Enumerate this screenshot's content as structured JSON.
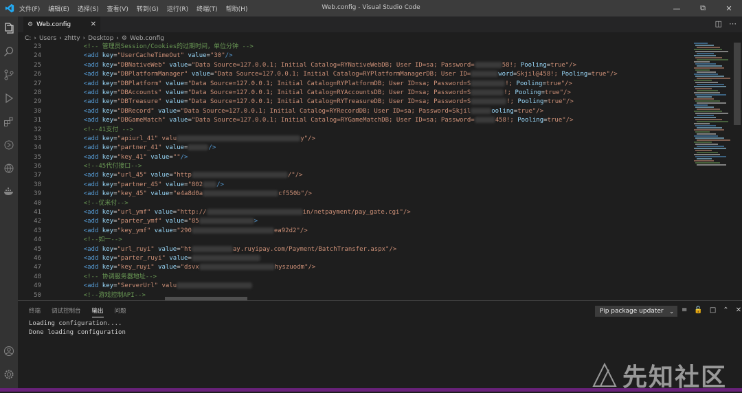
{
  "window": {
    "title": "Web.config - Visual Studio Code",
    "menu": [
      "文件(F)",
      "编辑(E)",
      "选择(S)",
      "查看(V)",
      "转到(G)",
      "运行(R)",
      "终端(T)",
      "帮助(H)"
    ]
  },
  "tab": {
    "label": "Web.config"
  },
  "breadcrumb": {
    "parts": [
      "C:",
      "Users",
      "zhtty",
      "Desktop",
      "Web.config"
    ]
  },
  "editor": {
    "lines": [
      {
        "n": "23",
        "text": "<!-- 管理员Session/Cookies的过期时间，单位分钟 -->"
      },
      {
        "n": "24",
        "text": "<add key=\"UserCacheTimeOut\" value=\"30\"/>"
      },
      {
        "n": "25",
        "text": "<add key=\"DBNativeWeb\" value=\"Data Source=127.0.0.1; Initial Catalog=RYNativeWebDB; User ID=sa; Password=",
        "tail": "58!; Pooling=true\"/>"
      },
      {
        "n": "26",
        "text": "<add key=\"DBPlatformManager\" value=\"Data Source=127.0.0.1; Initial Catalog=RYPlatformManagerDB; User ID=",
        "tail": "word=Skjil@458!; Pooling=true\"/>"
      },
      {
        "n": "27",
        "text": "<add key=\"DBPlatform\" value=\"Data Source=127.0.0.1; Initial Catalog=RYPlatformDB; User ID=sa; Password=S",
        "tail": "!; Pooling=true\"/>"
      },
      {
        "n": "28",
        "text": "<add key=\"DBAccounts\" value=\"Data Source=127.0.0.1; Initial Catalog=RYAccountsDB; User ID=sa; Password=S",
        "tail": "!; Pooling=true\"/>"
      },
      {
        "n": "29",
        "text": "<add key=\"DBTreasure\" value=\"Data Source=127.0.0.1; Initial Catalog=RYTreasureDB; User ID=sa; Password=S",
        "tail": "!; Pooling=true\"/>"
      },
      {
        "n": "30",
        "text": "<add key=\"DBRecord\" value=\"Data Source=127.0.0.1; Initial Catalog=RYRecordDB; User ID=sa; Password=Skjil",
        "tail": "ooling=true\"/>"
      },
      {
        "n": "31",
        "text": "<add key=\"DBGameMatch\" value=\"Data Source=127.0.0.1; Initial Catalog=RYGameMatchDB; User ID=sa; Password=",
        "tail": "458!; Pooling=true\"/>"
      },
      {
        "n": "32",
        "text": "<!--41支付 -->"
      },
      {
        "n": "33",
        "text": "<add key=\"apiurl_41\" valu",
        "tail": "y\"/>"
      },
      {
        "n": "34",
        "text": "<add key=\"partner_41\" value=",
        "tail": "/>"
      },
      {
        "n": "35",
        "text": "<add key=\"key_41\" value=\"\"/>"
      },
      {
        "n": "36",
        "text": "<!--45代付接口-->"
      },
      {
        "n": "37",
        "text": "<add key=\"url_45\" value=\"http",
        "tail": "/\"/>"
      },
      {
        "n": "38",
        "text": "<add key=\"partner_45\" value=\"802",
        "tail": "/>"
      },
      {
        "n": "39",
        "text": "<add key=\"key_45\" value=\"e4a8d0a",
        "tail": "cf550b\"/>"
      },
      {
        "n": "40",
        "text": "<!--优米付-->"
      },
      {
        "n": "41",
        "text": "<add key=\"url_ymf\" value=\"http://",
        "tail": "in/netpayment/pay_gate.cgi\"/>"
      },
      {
        "n": "42",
        "text": "<add key=\"parter_ymf\" value=\"85",
        "tail": ">"
      },
      {
        "n": "43",
        "text": "<add key=\"key_ymf\" value=\"290",
        "tail": "ea92d2\"/>"
      },
      {
        "n": "44",
        "text": "<!--如一-->"
      },
      {
        "n": "45",
        "text": "<add key=\"url_ruyi\" value=\"ht",
        "tail": "ay.ruyipay.com/Payment/BatchTransfer.aspx\"/>"
      },
      {
        "n": "46",
        "text": "<add key=\"parter_ruyi\" value=",
        "tail": ""
      },
      {
        "n": "47",
        "text": "<add key=\"key_ruyi\" value=\"dsvx",
        "tail": "hyszuodm\"/>"
      },
      {
        "n": "48",
        "text": "<!-- 协调服务器地址-->"
      },
      {
        "n": "49",
        "text": "<add key=\"ServerUrl\" valu",
        "tail": ""
      },
      {
        "n": "50",
        "text": "<!--游戏控制API-->"
      }
    ]
  },
  "panel": {
    "tabs": [
      "终端",
      "调试控制台",
      "输出",
      "问题"
    ],
    "active_tab": "输出",
    "select_value": "Pip package updater",
    "output": [
      "Loading configuration....",
      "Done loading configuration"
    ]
  },
  "watermark": {
    "text": "先知社区"
  },
  "colors": {
    "statusbar": "#68217a",
    "titlebar": "#3c3c3c",
    "editor_bg": "#1e1e1e"
  }
}
